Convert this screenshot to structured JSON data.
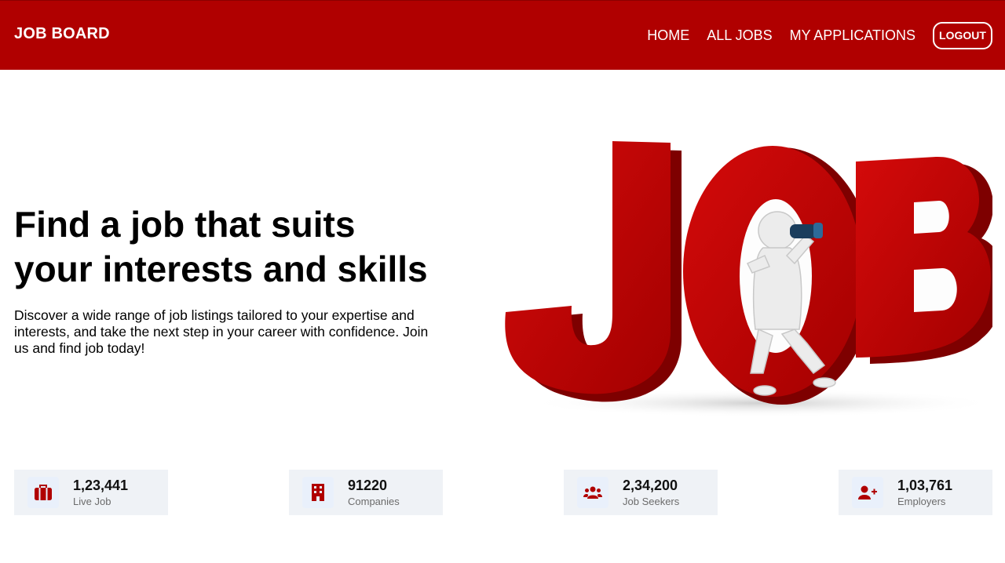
{
  "colors": {
    "brand_red": "#b00000",
    "card_bg": "#eff2f6",
    "selection": "#b4cbf0"
  },
  "navbar": {
    "brand": "JOB BOARD",
    "links": [
      {
        "label": "HOME"
      },
      {
        "label": "ALL JOBS"
      },
      {
        "label": "MY APPLICATIONS"
      }
    ],
    "logout_label": "LOGOUT"
  },
  "hero": {
    "title_line1": "Find a job that suits",
    "title_line2": "your interests and skills",
    "description": "Discover a wide range of job listings tailored to your expertise and interests, and take the next step in your career with confidence. Join us and find job today!",
    "image_text": "JOB",
    "image_icon": "figure-with-binoculars"
  },
  "stats": [
    {
      "value": "1,23,441",
      "label": "Live Job",
      "icon": "briefcase-icon"
    },
    {
      "value": "91220",
      "label": "Companies",
      "icon": "building-icon"
    },
    {
      "value": "2,34,200",
      "label": "Job Seekers",
      "icon": "users-icon"
    },
    {
      "value": "1,03,761",
      "label": "Employers",
      "icon": "user-plus-icon"
    }
  ]
}
